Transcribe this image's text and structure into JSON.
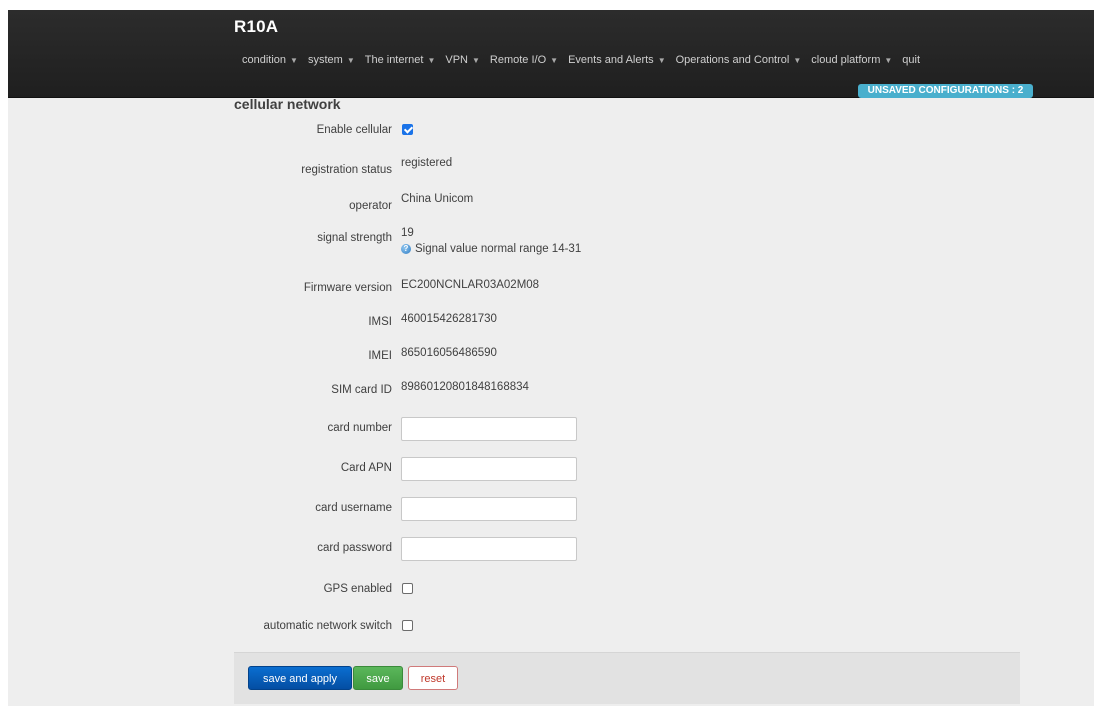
{
  "brand": "R10A",
  "menu": [
    {
      "label": "condition",
      "caret": true
    },
    {
      "label": "system",
      "caret": true
    },
    {
      "label": "The internet",
      "caret": true
    },
    {
      "label": "VPN",
      "caret": true
    },
    {
      "label": "Remote I/O",
      "caret": true
    },
    {
      "label": "Events and Alerts",
      "caret": true
    },
    {
      "label": "Operations and Control",
      "caret": true
    },
    {
      "label": "cloud platform",
      "caret": true
    },
    {
      "label": "quit",
      "caret": false
    }
  ],
  "unsaved_badge": "UNSAVED CONFIGURATIONS : 2",
  "section_title": "cellular network",
  "fields": {
    "enable_cellular": {
      "label": "Enable cellular",
      "checked": true
    },
    "registration_status": {
      "label": "registration status",
      "value": "registered"
    },
    "operator": {
      "label": "operator",
      "value": "China Unicom"
    },
    "signal_strength": {
      "label": "signal strength",
      "value": "19",
      "hint": "Signal value normal range 14-31"
    },
    "firmware_version": {
      "label": "Firmware version",
      "value": "EC200NCNLAR03A02M08"
    },
    "imsi": {
      "label": "IMSI",
      "value": "460015426281730"
    },
    "imei": {
      "label": "IMEI",
      "value": "865016056486590"
    },
    "sim_card_id": {
      "label": "SIM card ID",
      "value": "89860120801848168834"
    },
    "card_number": {
      "label": "card number",
      "value": ""
    },
    "card_apn": {
      "label": "Card APN",
      "value": ""
    },
    "card_username": {
      "label": "card username",
      "value": ""
    },
    "card_password": {
      "label": "card password",
      "value": ""
    },
    "gps_enabled": {
      "label": "GPS enabled",
      "checked": false
    },
    "auto_network_switch": {
      "label": "automatic network switch",
      "checked": false
    }
  },
  "buttons": {
    "save_and_apply": "save and apply",
    "save": "save",
    "reset": "reset"
  },
  "colors": {
    "navbar": "#222222",
    "badge": "#49afcd",
    "primary": "#0a6ed0",
    "success": "#5bb75b",
    "danger": "#c0392b"
  }
}
